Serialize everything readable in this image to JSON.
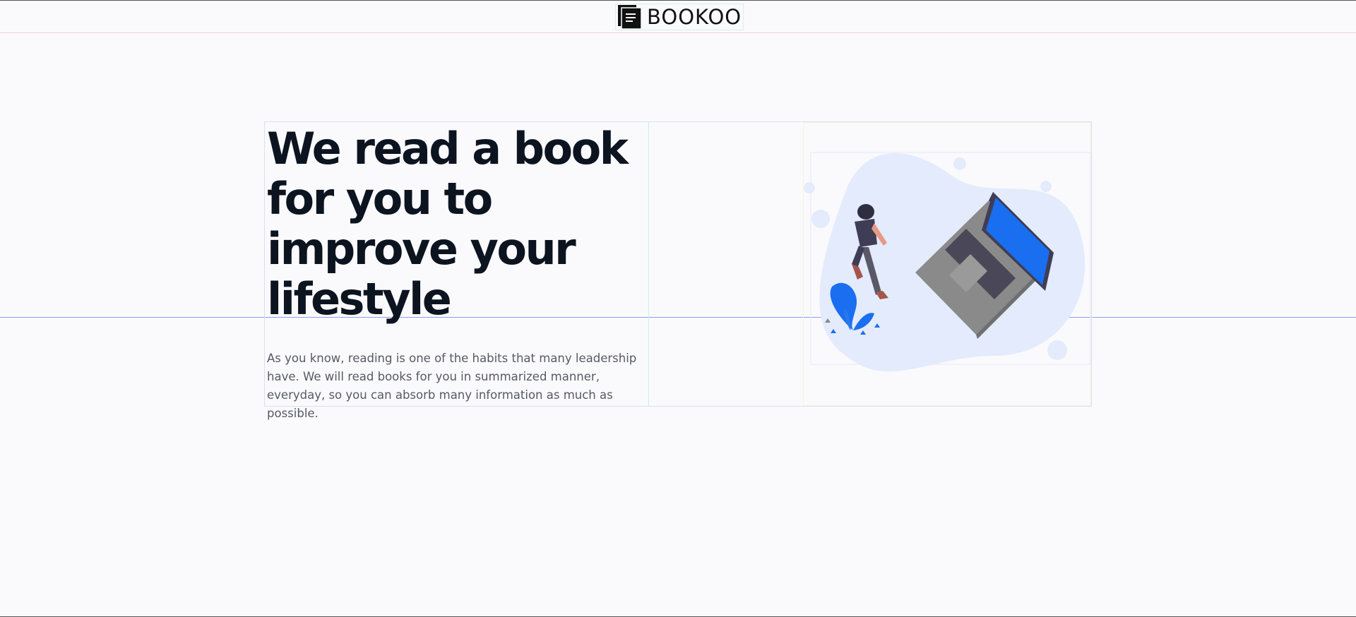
{
  "header": {
    "brand_name": "BOOKOO",
    "logo_icon": "book-stack-icon"
  },
  "hero": {
    "title": "We read a book for you to improve your lifestyle",
    "description": "As you know, reading is one of the habits that many leadership have. We will read books for you in summarized manner, everyday, so you can absorb many information as much as possible.",
    "illustration": "person-walking-beside-laptop-illustration"
  },
  "colors": {
    "background": "#fafafc",
    "title_text": "#0c1420",
    "body_text": "#555a66",
    "accent_blue": "#1a6ef0",
    "blob": "#e3ebfd",
    "laptop_body": "#8a8a8a"
  }
}
